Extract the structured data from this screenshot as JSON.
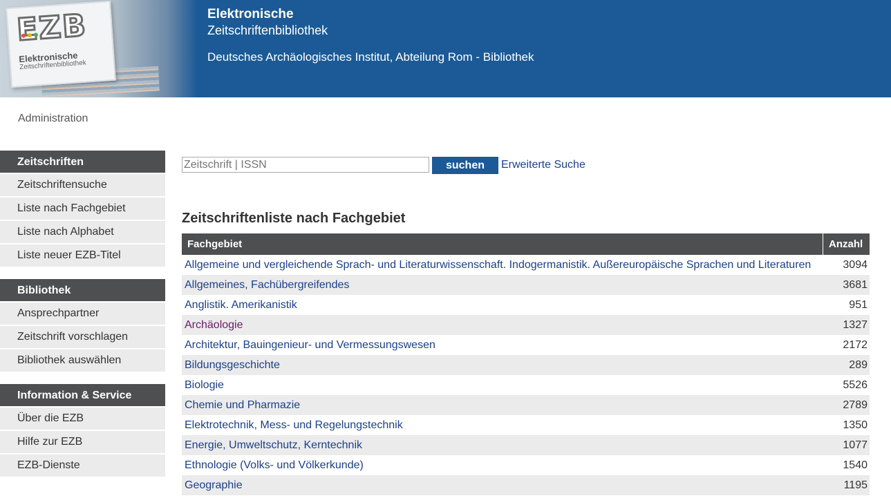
{
  "header": {
    "logo_letters": "EZB",
    "logo_line1": "Elektronische",
    "logo_line2": "Zeitschriftenbibliothek",
    "title_line1": "Elektronische",
    "title_line2": "Zeitschriftenbibliothek",
    "institution": "Deutsches Archäologisches Institut, Abteilung Rom - Bibliothek"
  },
  "admin_label": "Administration",
  "sidebar": {
    "sections": [
      {
        "heading": "Zeitschriften",
        "items": [
          "Zeitschriftensuche",
          "Liste nach Fachgebiet",
          "Liste nach Alphabet",
          "Liste neuer EZB-Titel"
        ]
      },
      {
        "heading": "Bibliothek",
        "items": [
          "Ansprechpartner",
          "Zeitschrift vorschlagen",
          "Bibliothek auswählen"
        ]
      },
      {
        "heading": "Information & Service",
        "items": [
          "Über die EZB",
          "Hilfe zur EZB",
          "EZB-Dienste"
        ]
      }
    ]
  },
  "search": {
    "placeholder": "Zeitschrift | ISSN",
    "button_label": "suchen",
    "advanced_label": "Erweiterte Suche"
  },
  "list_title": "Zeitschriftenliste nach Fachgebiet",
  "table": {
    "headers": [
      "Fachgebiet",
      "Anzahl"
    ],
    "rows": [
      {
        "subject": "Allgemeine und vergleichende Sprach- und Literaturwissenschaft. Indogermanistik. Außereuropäische Sprachen und Literaturen",
        "count": "3094"
      },
      {
        "subject": "Allgemeines, Fachübergreifendes",
        "count": "3681"
      },
      {
        "subject": "Anglistik. Amerikanistik",
        "count": "951"
      },
      {
        "subject": "Archäologie",
        "count": "1327",
        "visited": true
      },
      {
        "subject": "Architektur, Bauingenieur- und Vermessungswesen",
        "count": "2172"
      },
      {
        "subject": "Bildungsgeschichte",
        "count": "289"
      },
      {
        "subject": "Biologie",
        "count": "5526"
      },
      {
        "subject": "Chemie und Pharmazie",
        "count": "2789"
      },
      {
        "subject": "Elektrotechnik, Mess- und Regelungstechnik",
        "count": "1350"
      },
      {
        "subject": "Energie, Umweltschutz, Kerntechnik",
        "count": "1077"
      },
      {
        "subject": "Ethnologie (Volks- und Völkerkunde)",
        "count": "1540"
      },
      {
        "subject": "Geographie",
        "count": "1195"
      }
    ]
  },
  "colors": {
    "header_blue": "#1b5a96",
    "sidebar_dark": "#4d4f51",
    "row_gray": "#ebebeb",
    "link_blue": "#1b3f8f",
    "visited_purple": "#6b1a6b"
  }
}
